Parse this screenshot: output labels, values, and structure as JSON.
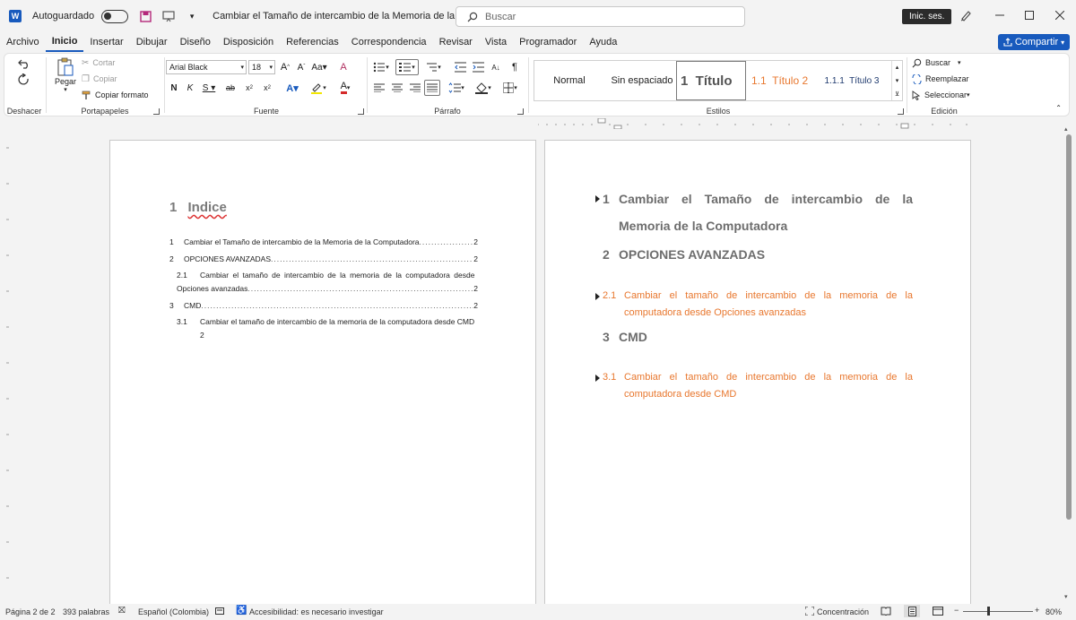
{
  "titlebar": {
    "autosave_label": "Autoguardado",
    "doc_title": "Cambiar el Tamaño de intercambio de la Memoria de la Computadora",
    "search_placeholder": "Buscar",
    "signin_label": "Inic. ses."
  },
  "menu": {
    "tabs": [
      "Archivo",
      "Inicio",
      "Insertar",
      "Dibujar",
      "Diseño",
      "Disposición",
      "Referencias",
      "Correspondencia",
      "Revisar",
      "Vista",
      "Programador",
      "Ayuda"
    ],
    "active": "Inicio",
    "share_label": "Compartir"
  },
  "ribbon": {
    "undo_group": "Deshacer",
    "clipboard": {
      "group": "Portapapeles",
      "paste": "Pegar",
      "cut": "Cortar",
      "copy": "Copiar",
      "format_painter": "Copiar formato"
    },
    "font": {
      "group": "Fuente",
      "font_name": "Arial Black",
      "font_size": "18"
    },
    "paragraph": {
      "group": "Párrafo"
    },
    "styles": {
      "group": "Estilos",
      "items": [
        "Normal",
        "Sin espaciado",
        "1  Título",
        "1.1  Título 2",
        "1.1.1  Título 3"
      ]
    },
    "editing": {
      "group": "Edición",
      "find": "Buscar",
      "replace": "Reemplazar",
      "select": "Seleccionar"
    }
  },
  "page1": {
    "toc_num": "1",
    "toc_title": "Indice",
    "entries": [
      {
        "num": "1",
        "text": "Cambiar el Tamaño de intercambio de la Memoria de la Computadora",
        "page": "2"
      },
      {
        "num": "2",
        "text": "OPCIONES AVANZADAS",
        "page": "2"
      },
      {
        "num": "2.1",
        "text": "Cambiar el tamaño de intercambio de la memoria de la computadora desde",
        "text2": "Opciones avanzadas",
        "page": "2"
      },
      {
        "num": "3",
        "text": "CMD",
        "page": "2"
      },
      {
        "num": "3.1",
        "text": "Cambiar el tamaño de intercambio de la memoria de la computadora desde CMD",
        "page": "2"
      }
    ]
  },
  "page2": {
    "h1_1_num": "1",
    "h1_1_line1": "Cambiar el Tamaño de intercambio de la",
    "h1_1_line2": "Memoria de la Computadora",
    "h1_2_num": "2",
    "h1_2_text": "OPCIONES AVANZADAS",
    "h2_1_num": "2.1",
    "h2_1_line1": "Cambiar el tamaño de intercambio de la memoria de la",
    "h2_1_line2": "computadora desde Opciones avanzadas",
    "h1_3_num": "3",
    "h1_3_text": "CMD",
    "h2_2_num": "3.1",
    "h2_2_line1": "Cambiar el tamaño de intercambio de la memoria de la",
    "h2_2_line2": "computadora desde CMD"
  },
  "status": {
    "page": "Página 2 de 2",
    "words": "393 palabras",
    "language": "Español (Colombia)",
    "accessibility": "Accesibilidad: es necesario investigar",
    "focus": "Concentración",
    "zoom": "80%"
  },
  "colors": {
    "accent": "#185abd",
    "heading_gray": "#6d6d6d",
    "heading_orange": "#e8772e"
  }
}
